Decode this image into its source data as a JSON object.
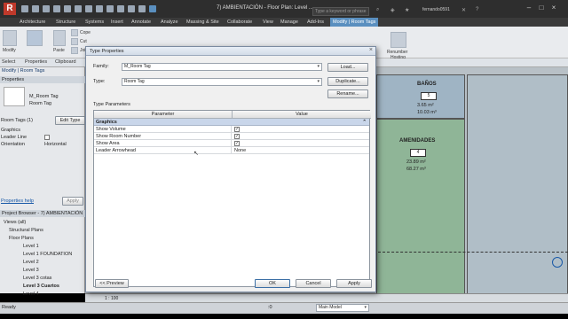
{
  "titlebar": {
    "title": "7) AMBIENTACIÓN - Floor Plan: Level ...",
    "search_placeholder": "Type a keyword or phrase",
    "user": "fernando0591"
  },
  "ribbon_tabs": [
    "Architecture",
    "Structure",
    "Systems",
    "Insert",
    "Annotate",
    "Analyze",
    "Massing & Site",
    "Collaborate",
    "View",
    "Manage",
    "Add-Ins",
    "Modify | Room Tags"
  ],
  "ribbon": {
    "modify": "Modify",
    "select": "Select",
    "properties": "Properties",
    "clipboard": "Clipboard",
    "paste": "Paste",
    "cope": "Cope",
    "cut": "Cut",
    "join": "Join",
    "horizontal": "Horiz",
    "renumber": "Renumber",
    "hosting": "Hosting"
  },
  "option_bar": {
    "context": "Modify | Room Tags"
  },
  "properties_panel": {
    "header": "Properties",
    "type_name_1": "M_Room Tag",
    "type_name_2": "Room Tag",
    "selector": "Room Tags (1)",
    "edit_type": "Edit Type",
    "section": "Graphics",
    "leader_label": "Leader Line",
    "orientation_label": "Orientation",
    "orientation_value": "Horizontal",
    "help": "Properties help",
    "apply": "Apply"
  },
  "project_browser": {
    "header": "Project Browser - 7) AMBIENTACIÓN",
    "items": [
      "Views (all)",
      "Structural Plans",
      "Floor Plans",
      "Level 1",
      "Level 1 FOUNDATION",
      "Level 2",
      "Level 3",
      "Level 3 cotas",
      "Level 3 Cuartos",
      "Level 4"
    ]
  },
  "canvas": {
    "room1": {
      "name": "BAÑOS",
      "number": "5",
      "area": "3.65 m²",
      "volume": "10.03 m³"
    },
    "room2": {
      "name": "AMENIDADES",
      "number": "4",
      "area": "23.89 m²",
      "volume": "68.27 m³"
    }
  },
  "status": {
    "ready": "Ready",
    "scale": "1 : 100",
    "model": "Main Model",
    "zero": ":0"
  },
  "dialog": {
    "title": "Type Properties",
    "family_label": "Family:",
    "family_value": "M_Room Tag",
    "type_label": "Type:",
    "type_value": "Room Tag",
    "load_btn": "Load...",
    "duplicate_btn": "Duplicate...",
    "rename_btn": "Rename...",
    "type_params_label": "Type Parameters",
    "col_parameter": "Parameter",
    "col_value": "Value",
    "group": "Graphics",
    "rows": [
      {
        "name": "Show Volume",
        "value": "checked"
      },
      {
        "name": "Show Room Number",
        "value": "checked"
      },
      {
        "name": "Show Area",
        "value": "checked"
      },
      {
        "name": "Leader Arrowhead",
        "value": "None"
      }
    ],
    "preview_btn": "<< Preview",
    "ok_btn": "OK",
    "cancel_btn": "Cancel",
    "apply_btn": "Apply"
  }
}
